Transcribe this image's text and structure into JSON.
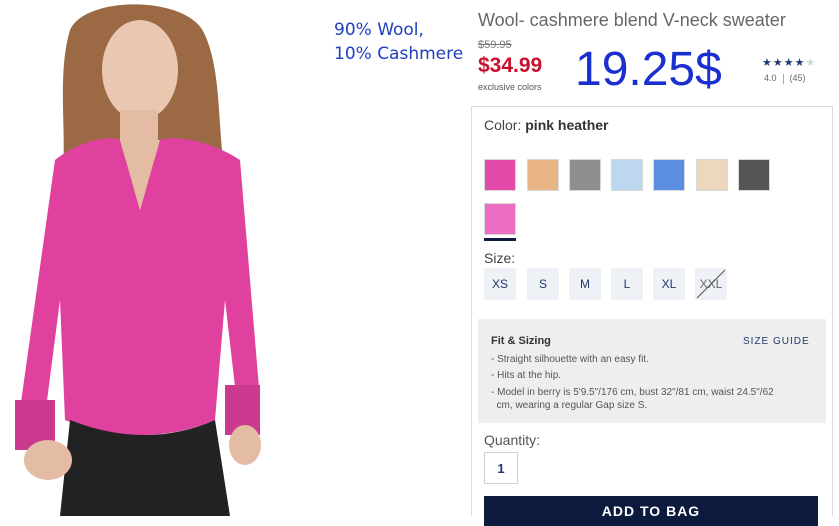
{
  "annotation": {
    "line1": "90% Wool,",
    "line2": "10% Cashmere",
    "handwritten_price": "19.25$"
  },
  "product": {
    "title": "Wool- cashmere blend V-neck sweater",
    "original_price": "$59.95",
    "sale_price": "$34.99",
    "exclusive_note": "exclusive colors",
    "rating": {
      "stars": 4,
      "value": "4.0",
      "reviews": "(45)"
    }
  },
  "color": {
    "label": "Color:",
    "selected": "pink heather",
    "swatches": [
      {
        "color": "#e14aa6"
      },
      {
        "color": "#e8b483"
      },
      {
        "color": "#8e8e8e"
      },
      {
        "color": "#bcd7ee"
      },
      {
        "color": "#5a8ee0"
      },
      {
        "color": "#ecd8bf"
      },
      {
        "color": "#555555"
      },
      {
        "color": "#ec6ec2"
      }
    ]
  },
  "size": {
    "label": "Size:",
    "options": [
      "XS",
      "S",
      "M",
      "L",
      "XL",
      "XXL"
    ],
    "unavailable": "XXL"
  },
  "fit": {
    "title": "Fit & Sizing",
    "guide_link": "SIZE GUIDE",
    "bullets": [
      "- Straight silhouette with an easy fit.",
      "- Hits at the hip.",
      "- Model in berry is 5'9.5\"/176 cm, bust 32\"/81 cm, waist 24.5\"/62",
      "  cm, wearing a regular Gap size S."
    ]
  },
  "quantity": {
    "label": "Quantity:",
    "value": "1"
  },
  "add_to_bag": "ADD TO BAG",
  "colors": {
    "sale_red": "#c8102e",
    "navy": "#0b1a3d",
    "link_blue": "#1e3a6e",
    "annotation_blue": "#1a2fd0"
  }
}
